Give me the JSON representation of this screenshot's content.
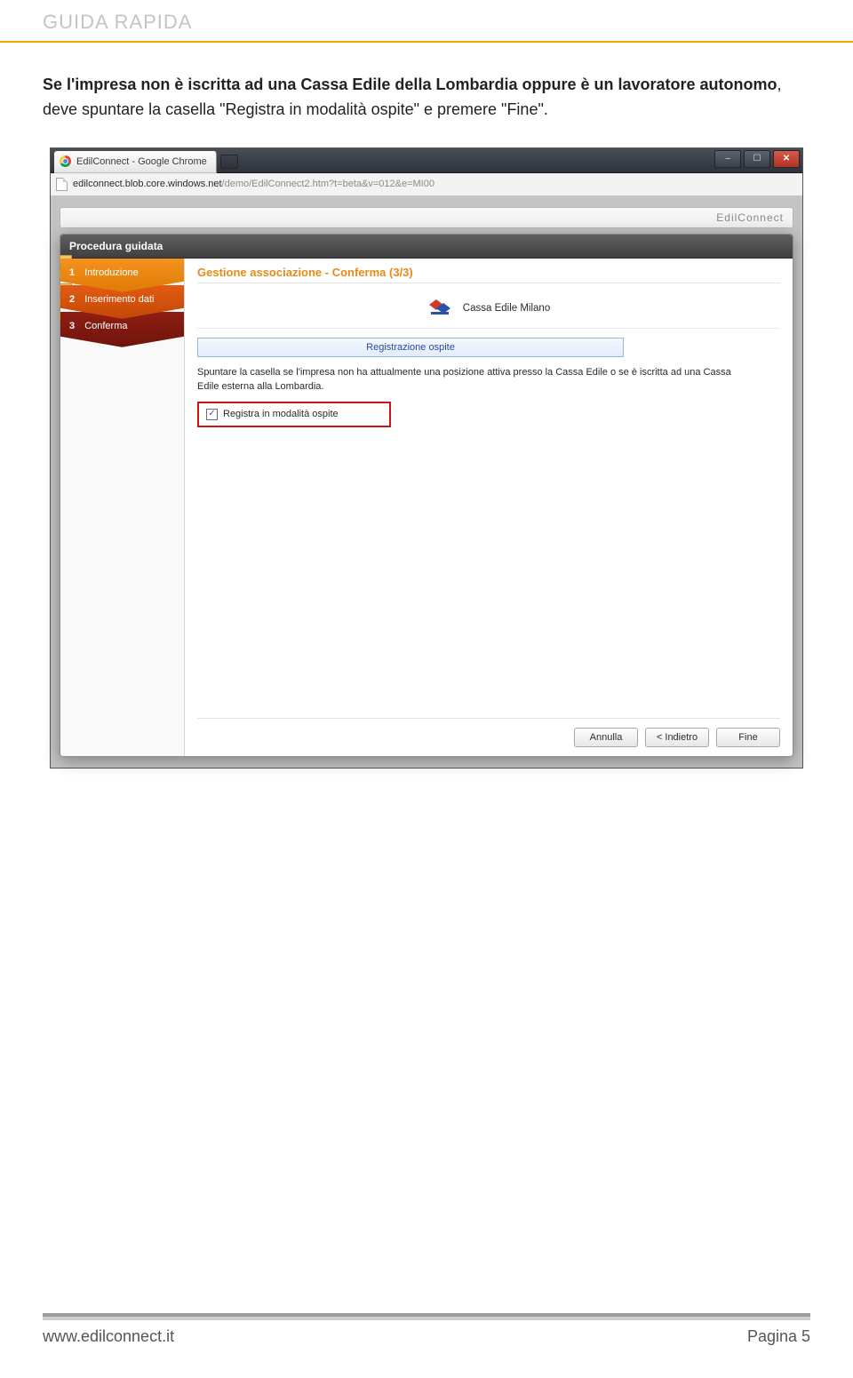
{
  "page": {
    "headerLabel": "GUIDA RAPIDA",
    "intro": {
      "bold1": "Se l'impresa non è iscritta ad una Cassa Edile della Lombardia oppure è un lavoratore autonomo",
      "plain1": ", deve spuntare la casella \"Registra in modalità ospite\" e premere \"Fine\"."
    },
    "footerSite": "www.edilconnect.it",
    "footerPage": "Pagina 5"
  },
  "browser": {
    "tabTitle": "EdilConnect - Google Chrome",
    "urlDomain": "edilconnect.blob.core.windows.net",
    "urlRest": "/demo/EdilConnect2.htm?t=beta&v=012&e=MI00",
    "peekBrand": "EdilConnect",
    "winMin": "–",
    "winMax": "☐",
    "winClose": "✕"
  },
  "modal": {
    "title": "Procedura guidata",
    "steps": [
      {
        "num": "1",
        "label": "Introduzione"
      },
      {
        "num": "2",
        "label": "Inserimento dati"
      },
      {
        "num": "3",
        "label": "Conferma"
      }
    ],
    "heading": "Gestione associazione - Conferma (3/3)",
    "brandName": "Cassa Edile Milano",
    "sectionTitle": "Registrazione ospite",
    "description": "Spuntare la casella se l'impresa non ha attualmente una posizione attiva presso la Cassa Edile o se è iscritta ad una Cassa Edile esterna alla Lombardia.",
    "checkboxLabel": "Registra in modalità ospite",
    "checkboxCheckedGlyph": "✓",
    "buttons": {
      "cancel": "Annulla",
      "back": "<  Indietro",
      "finish": "Fine"
    }
  }
}
